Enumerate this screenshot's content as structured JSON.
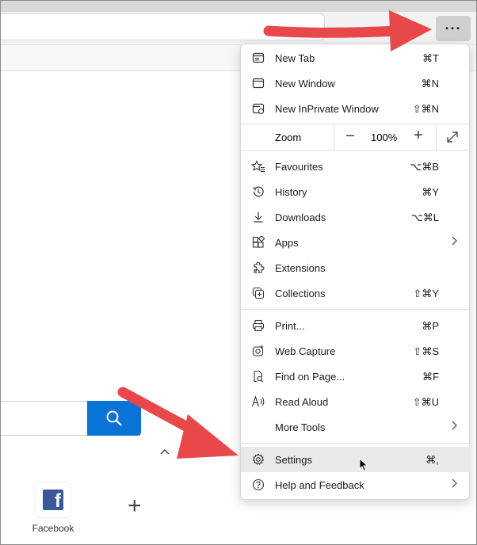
{
  "toolbar": {
    "more_label": "···"
  },
  "menu": {
    "items_a": [
      {
        "icon": "new-tab-icon",
        "label": "New Tab",
        "shortcut": "⌘T"
      },
      {
        "icon": "new-window-icon",
        "label": "New Window",
        "shortcut": "⌘N"
      },
      {
        "icon": "inprivate-icon",
        "label": "New InPrivate Window",
        "shortcut": "⇧⌘N"
      }
    ],
    "zoom": {
      "label": "Zoom",
      "value": "100%",
      "minus": "−",
      "plus": "+"
    },
    "items_b": [
      {
        "icon": "favourites-icon",
        "label": "Favourites",
        "shortcut": "⌥⌘B"
      },
      {
        "icon": "history-icon",
        "label": "History",
        "shortcut": "⌘Y"
      },
      {
        "icon": "downloads-icon",
        "label": "Downloads",
        "shortcut": "⌥⌘L"
      },
      {
        "icon": "apps-icon",
        "label": "Apps",
        "shortcut": "",
        "submenu": true
      },
      {
        "icon": "extensions-icon",
        "label": "Extensions",
        "shortcut": ""
      },
      {
        "icon": "collections-icon",
        "label": "Collections",
        "shortcut": "⇧⌘Y"
      }
    ],
    "items_c": [
      {
        "icon": "print-icon",
        "label": "Print...",
        "shortcut": "⌘P"
      },
      {
        "icon": "web-capture-icon",
        "label": "Web Capture",
        "shortcut": "⇧⌘S"
      },
      {
        "icon": "find-icon",
        "label": "Find on Page...",
        "shortcut": "⌘F"
      },
      {
        "icon": "read-aloud-icon",
        "label": "Read Aloud",
        "shortcut": "⇧⌘U"
      },
      {
        "icon": "",
        "label": "More Tools",
        "shortcut": "",
        "submenu": true
      }
    ],
    "items_d": [
      {
        "icon": "settings-icon",
        "label": "Settings",
        "shortcut": "⌘,",
        "highlight": true
      },
      {
        "icon": "help-icon",
        "label": "Help and Feedback",
        "shortcut": "",
        "submenu": true
      }
    ]
  },
  "page": {
    "add_symbol": "+",
    "caret": "⌃",
    "tiles": [
      {
        "label": "Facebook",
        "icon": "facebook-icon"
      }
    ]
  },
  "colors": {
    "accent": "#0a74d6",
    "arrow": "#ee4d4d",
    "highlight": "#e9e9e9"
  }
}
